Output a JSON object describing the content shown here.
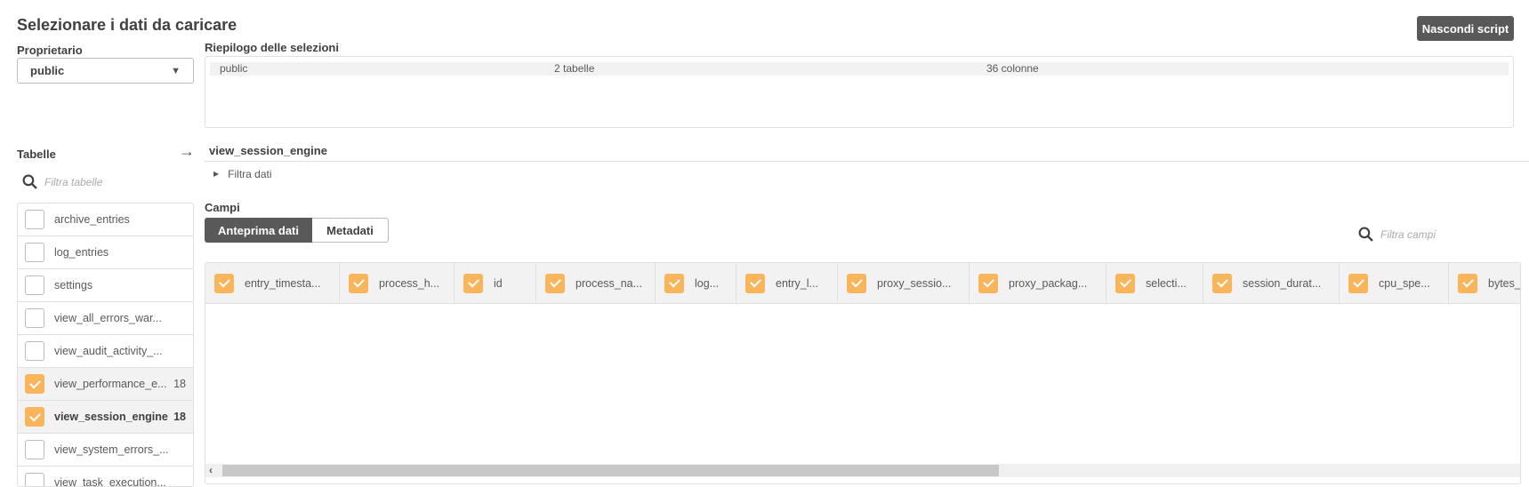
{
  "title": "Selezionare i dati da caricare",
  "hide_script_label": "Nascondi script",
  "owner": {
    "label": "Proprietario",
    "value": "public"
  },
  "summary": {
    "label": "Riepilogo delle selezioni",
    "rows": [
      {
        "owner": "public",
        "tables": "2 tabelle",
        "columns": "36 colonne"
      }
    ]
  },
  "tables": {
    "label": "Tabelle",
    "filter_placeholder": "Filtra tabelle",
    "items": [
      {
        "name": "archive_entries",
        "checked": false,
        "count": ""
      },
      {
        "name": "log_entries",
        "checked": false,
        "count": ""
      },
      {
        "name": "settings",
        "checked": false,
        "count": ""
      },
      {
        "name": "view_all_errors_war...",
        "checked": false,
        "count": ""
      },
      {
        "name": "view_audit_activity_...",
        "checked": false,
        "count": ""
      },
      {
        "name": "view_performance_e...",
        "checked": true,
        "count": "18"
      },
      {
        "name": "view_session_engine",
        "checked": true,
        "count": "18",
        "active": true
      },
      {
        "name": "view_system_errors_...",
        "checked": false,
        "count": ""
      },
      {
        "name": "view_task_execution...",
        "checked": false,
        "count": ""
      }
    ]
  },
  "selected_table": "view_session_engine",
  "filter_data_label": "Filtra dati",
  "fields": {
    "label": "Campi",
    "tabs": [
      "Anteprima dati",
      "Metadati"
    ],
    "active_tab": "Anteprima dati",
    "filter_placeholder": "Filtra campi",
    "columns": [
      "entry_timesta...",
      "process_h...",
      "id",
      "process_na...",
      "log...",
      "entry_l...",
      "proxy_sessio...",
      "proxy_packag...",
      "selecti...",
      "session_durat...",
      "cpu_spe...",
      "bytes_rec"
    ]
  },
  "colors": {
    "accent": "#f8b55c",
    "dark_button": "#595959"
  }
}
